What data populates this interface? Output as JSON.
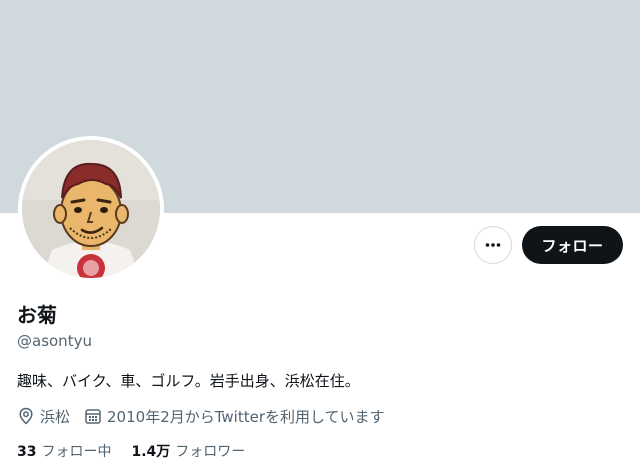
{
  "profile": {
    "display_name": "お菊",
    "handle": "@asontyu",
    "bio": "趣味、バイク、車、ゴルフ。岩手出身、浜松在住。",
    "location": "浜松",
    "joined": "2010年2月からTwitterを利用しています"
  },
  "actions": {
    "follow_label": "フォロー",
    "more_icon": "more-horizontal-icon"
  },
  "stats": {
    "following_count": "33",
    "following_label": "フォロー中",
    "followers_count": "1.4万",
    "followers_label": "フォロワー"
  },
  "icons": {
    "location": "location-pin-icon",
    "calendar": "calendar-icon"
  },
  "colors": {
    "banner": "#cfd9de",
    "text_primary": "#0f1419",
    "text_secondary": "#536471",
    "follow_button_bg": "#0f1419"
  }
}
